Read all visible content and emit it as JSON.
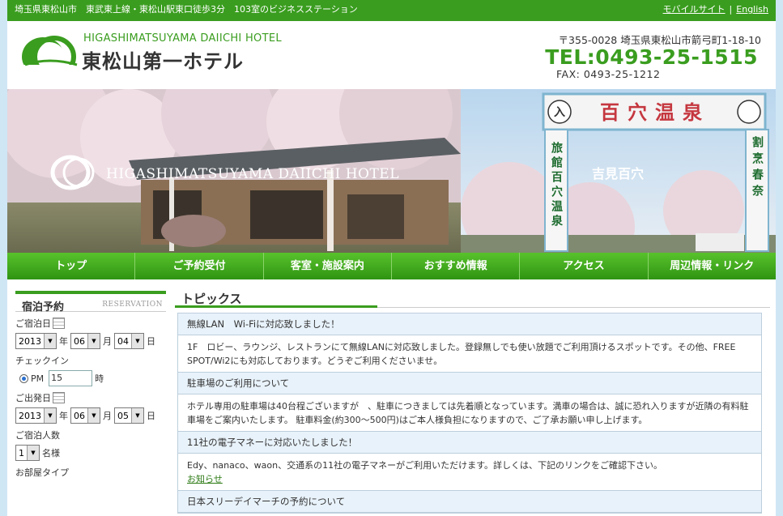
{
  "topbar": {
    "tagline": "埼玉県東松山市　東武東上線・東松山駅東口徒歩3分　103室のビジネスステーション",
    "mobile_link": "モバイルサイト",
    "separator": "|",
    "english_link": "English"
  },
  "header": {
    "hotel_name_en": "HIGASHIMATSUYAMA DAIICHI HOTEL",
    "hotel_name_jp": "東松山第一ホテル",
    "address": "〒355-0028 埼玉県東松山市箭弓町1-18-10",
    "tel": "TEL:0493-25-1515",
    "fax": "FAX: 0493-25-1212"
  },
  "banner": {
    "overlay_title": "HIGASHIMATSUYAMA DAIICHI HOTEL",
    "caption": "吉見百穴",
    "sign_entrance": "入",
    "sign_main": "百穴温泉",
    "sign_side_left": "旅館百穴温泉",
    "sign_side_right": "割烹春奈"
  },
  "nav": {
    "items": [
      "トップ",
      "ご予約受付",
      "客室・施設案内",
      "おすすめ情報",
      "アクセス",
      "周辺情報・リンク"
    ]
  },
  "reservation": {
    "heading": "宿泊予約",
    "heading_en": "RESERVATION",
    "checkin_date_label": "ご宿泊日",
    "checkin_year": "2013",
    "checkin_month": "06",
    "checkin_day": "04",
    "unit_year": "年",
    "unit_month": "月",
    "unit_day": "日",
    "checkin_time_label": "チェックイン",
    "checkin_ampm": "PM",
    "checkin_hour": "15",
    "unit_hour": "時",
    "checkout_date_label": "ご出発日",
    "checkout_year": "2013",
    "checkout_month": "06",
    "checkout_day": "05",
    "guests_label": "ご宿泊人数",
    "guests_value": "1",
    "guests_unit": "名様",
    "room_type_label": "お部屋タイプ"
  },
  "topics": {
    "heading": "トピックス",
    "items": [
      {
        "title": "無線LAN　Wi-Fiに対応致しました！",
        "body": "1F　ロビー、ラウンジ、レストランにて無線LANに対応致しました。登録無しでも使い放題でご利用頂けるスポットです。その他、FREE SPOT/Wi2にも対応しております。どうぞご利用くださいませ。"
      },
      {
        "title": "駐車場のご利用について",
        "body": "ホテル専用の駐車場は40台程ございますが　、駐車につきましては先着順となっています。満車の場合は、誠に恐れ入りますが近隣の有料駐車場をご案内いたします。 駐車料金(約300～500円)はご本人様負担になりますので、ご了承お願い申し上げます。"
      },
      {
        "title": "11社の電子マネーに対応いたしました！",
        "body": "Edy、nanaco、waon、交通系の11社の電子マネーがご利用いただけます。詳しくは、下記のリンクをご確認下さい。",
        "link": "お知らせ"
      },
      {
        "title": "日本スリーデイマーチの予約について"
      }
    ]
  },
  "colors": {
    "brand_green": "#3a9d1f",
    "page_bg": "#cfe6f5",
    "topic_header_bg": "#e8f2fa"
  }
}
